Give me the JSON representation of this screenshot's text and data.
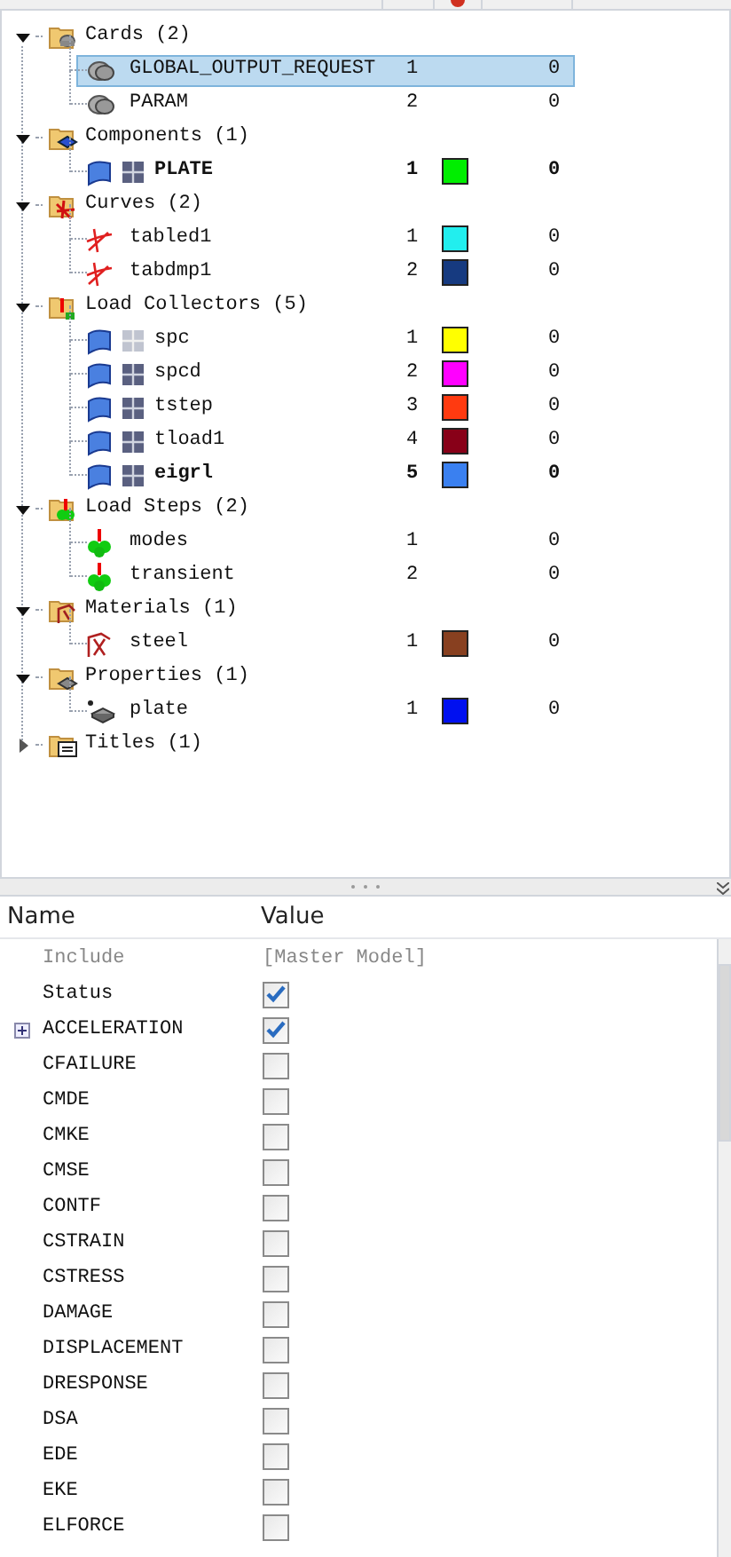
{
  "tree": [
    {
      "label": "Cards (2)",
      "kind": "cards",
      "expanded": true,
      "children": [
        {
          "name": "GLOBAL_OUTPUT_REQUEST",
          "id": "1",
          "include": "0",
          "current": false,
          "selected": true
        },
        {
          "name": "PARAM",
          "id": "2",
          "include": "0",
          "current": false,
          "selected": false
        }
      ]
    },
    {
      "label": "Components (1)",
      "kind": "components",
      "expanded": true,
      "children": [
        {
          "name": "PLATE",
          "id": "1",
          "color": "#00ee00",
          "include": "0",
          "current": true,
          "selected": false,
          "mesh_visible": true
        }
      ]
    },
    {
      "label": "Curves (2)",
      "kind": "curves",
      "expanded": true,
      "children": [
        {
          "name": "tabled1",
          "id": "1",
          "color": "#22eeee",
          "include": "0",
          "current": false,
          "selected": false
        },
        {
          "name": "tabdmp1",
          "id": "2",
          "color": "#163a80",
          "include": "0",
          "current": false,
          "selected": false
        }
      ]
    },
    {
      "label": "Load Collectors (5)",
      "kind": "loadcols",
      "expanded": true,
      "children": [
        {
          "name": "spc",
          "id": "1",
          "color": "#ffff00",
          "include": "0",
          "current": false,
          "selected": false,
          "mesh_visible": false
        },
        {
          "name": "spcd",
          "id": "2",
          "color": "#ff00ff",
          "include": "0",
          "current": false,
          "selected": false,
          "mesh_visible": true
        },
        {
          "name": "tstep",
          "id": "3",
          "color": "#ff3a10",
          "include": "0",
          "current": false,
          "selected": false,
          "mesh_visible": true
        },
        {
          "name": "tload1",
          "id": "4",
          "color": "#880018",
          "include": "0",
          "current": false,
          "selected": false,
          "mesh_visible": true
        },
        {
          "name": "eigrl",
          "id": "5",
          "color": "#3a80f0",
          "include": "0",
          "current": true,
          "selected": false,
          "mesh_visible": true
        }
      ]
    },
    {
      "label": "Load Steps (2)",
      "kind": "loadsteps",
      "expanded": true,
      "children": [
        {
          "name": "modes",
          "id": "1",
          "include": "0",
          "current": false,
          "selected": false
        },
        {
          "name": "transient",
          "id": "2",
          "include": "0",
          "current": false,
          "selected": false
        }
      ]
    },
    {
      "label": "Materials (1)",
      "kind": "materials",
      "expanded": true,
      "children": [
        {
          "name": "steel",
          "id": "1",
          "color": "#884020",
          "include": "0",
          "current": false,
          "selected": false
        }
      ]
    },
    {
      "label": "Properties (1)",
      "kind": "properties",
      "expanded": true,
      "children": [
        {
          "name": "plate",
          "id": "1",
          "color": "#0010f0",
          "include": "0",
          "current": false,
          "selected": false
        }
      ]
    },
    {
      "label": "Titles (1)",
      "kind": "titles",
      "expanded": false
    }
  ],
  "properties": {
    "columns": [
      "Name",
      "Value"
    ],
    "rows": [
      {
        "name": "Include",
        "kind": "text",
        "value": "[Master Model]",
        "disabled": true
      },
      {
        "name": "Status",
        "kind": "check",
        "checked": true,
        "disabled": false
      },
      {
        "name": "ACCELERATION",
        "kind": "check",
        "checked": true,
        "disabled": false,
        "expandable": true
      },
      {
        "name": "CFAILURE",
        "kind": "check",
        "checked": false,
        "disabled": false
      },
      {
        "name": "CMDE",
        "kind": "check",
        "checked": false,
        "disabled": false
      },
      {
        "name": "CMKE",
        "kind": "check",
        "checked": false,
        "disabled": false
      },
      {
        "name": "CMSE",
        "kind": "check",
        "checked": false,
        "disabled": false
      },
      {
        "name": "CONTF",
        "kind": "check",
        "checked": false,
        "disabled": false
      },
      {
        "name": "CSTRAIN",
        "kind": "check",
        "checked": false,
        "disabled": false
      },
      {
        "name": "CSTRESS",
        "kind": "check",
        "checked": false,
        "disabled": false
      },
      {
        "name": "DAMAGE",
        "kind": "check",
        "checked": false,
        "disabled": false
      },
      {
        "name": "DISPLACEMENT",
        "kind": "check",
        "checked": false,
        "disabled": false
      },
      {
        "name": "DRESPONSE",
        "kind": "check",
        "checked": false,
        "disabled": false
      },
      {
        "name": "DSA",
        "kind": "check",
        "checked": false,
        "disabled": false
      },
      {
        "name": "EDE",
        "kind": "check",
        "checked": false,
        "disabled": false
      },
      {
        "name": "EKE",
        "kind": "check",
        "checked": false,
        "disabled": false
      },
      {
        "name": "ELFORCE",
        "kind": "check",
        "checked": false,
        "disabled": false
      }
    ]
  }
}
